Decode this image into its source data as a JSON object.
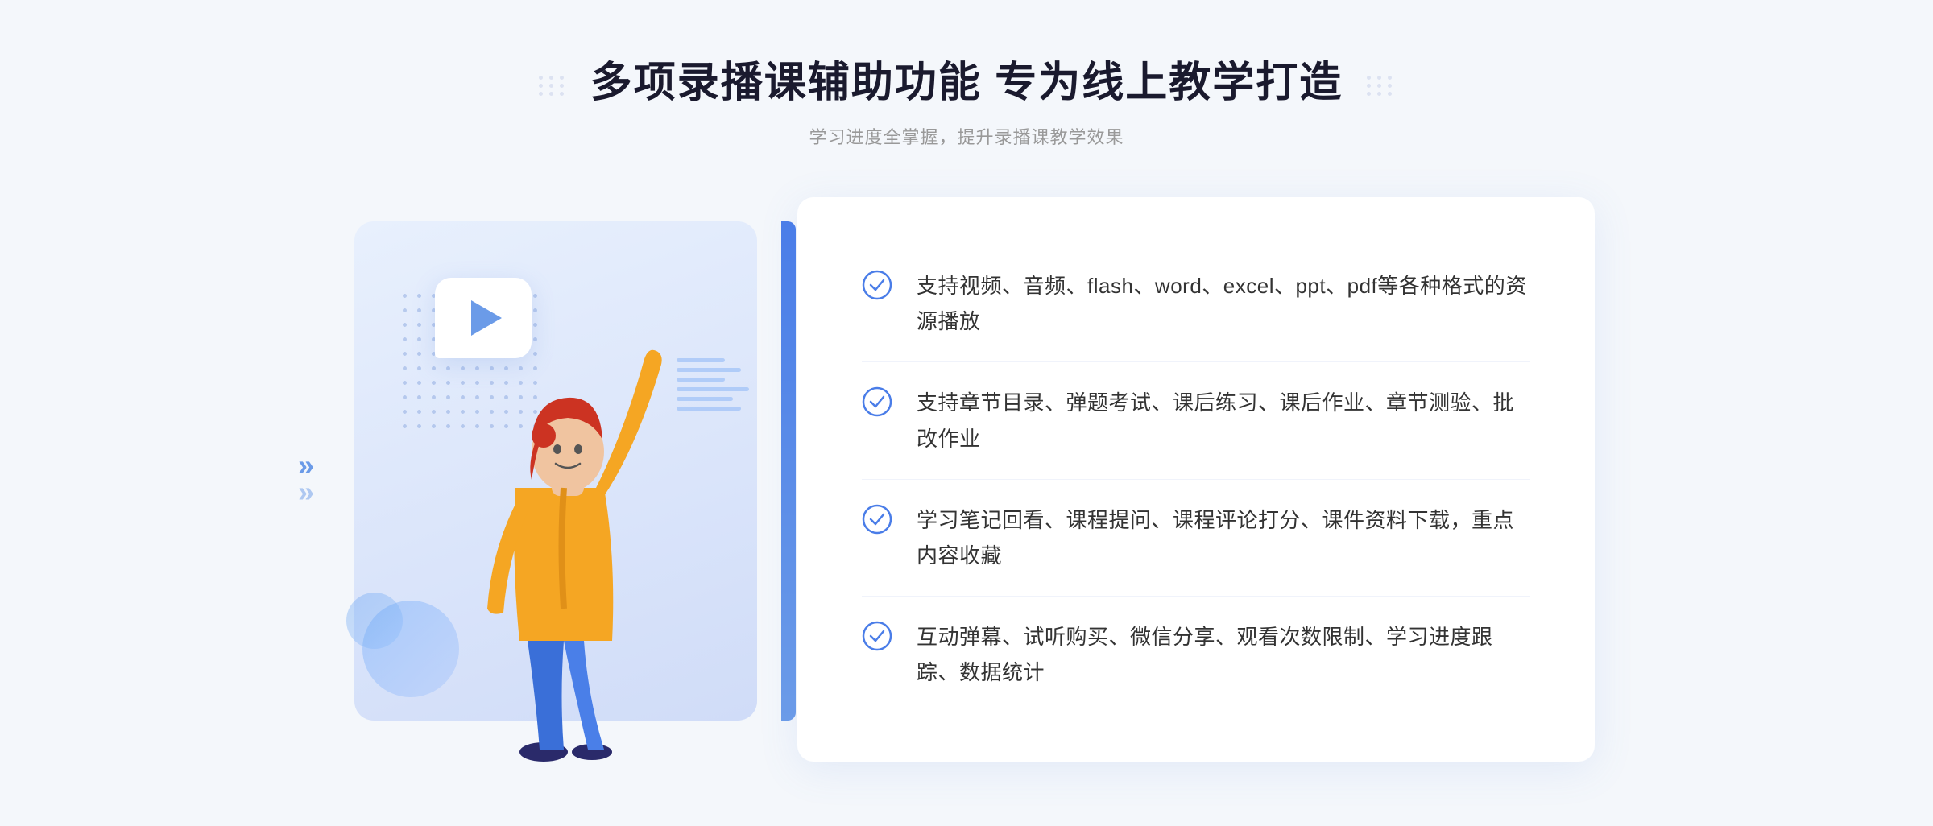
{
  "header": {
    "title": "多项录播课辅助功能 专为线上教学打造",
    "subtitle": "学习进度全掌握，提升录播课教学效果"
  },
  "features": [
    {
      "id": "feature-1",
      "text": "支持视频、音频、flash、word、excel、ppt、pdf等各种格式的资源播放"
    },
    {
      "id": "feature-2",
      "text": "支持章节目录、弹题考试、课后练习、课后作业、章节测验、批改作业"
    },
    {
      "id": "feature-3",
      "text": "学习笔记回看、课程提问、课程评论打分、课件资料下载，重点内容收藏"
    },
    {
      "id": "feature-4",
      "text": "互动弹幕、试听购买、微信分享、观看次数限制、学习进度跟踪、数据统计"
    }
  ],
  "decorative": {
    "dots_left": "⁞⁞",
    "dots_right": "⁞⁞",
    "arrow_left": "»",
    "play_button": "▶"
  },
  "colors": {
    "primary": "#4a7de8",
    "primary_light": "#6b9be8",
    "accent_blue": "#3366cc",
    "text_dark": "#1a1a2e",
    "text_muted": "#999999",
    "check_color": "#4a7de8"
  }
}
